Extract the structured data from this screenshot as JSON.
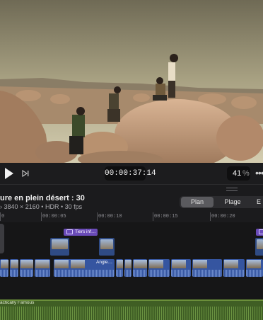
{
  "viewer": {
    "description_icon": "video-frame"
  },
  "transport": {
    "play_icon": "play-icon",
    "step_icon": "step-forward-icon",
    "timecode": "00:00:37:14",
    "zoom_value": "41",
    "zoom_unit": "%",
    "more_icon": "more-icon"
  },
  "project": {
    "title": "ure en plein désert : 30",
    "meta": "› 3840 × 2160 • HDR • 30 fps"
  },
  "view_modes": {
    "items": [
      "Plan",
      "Plage",
      "E"
    ],
    "selected": "Plan"
  },
  "ruler": {
    "labels": [
      "0",
      "00:00:05",
      "00:00:10",
      "00:00:15",
      "00:00:20"
    ]
  },
  "timeline": {
    "title_clip_1": "Tiers inf…",
    "primary_clip_label": "Angle…",
    "music_label": "actically Famous"
  },
  "colors": {
    "title_clip": "#6a4bb8",
    "primary_clip": "#3555a0",
    "music_clip": "#3f5e24",
    "selected_tab": "#5a5a5e"
  }
}
